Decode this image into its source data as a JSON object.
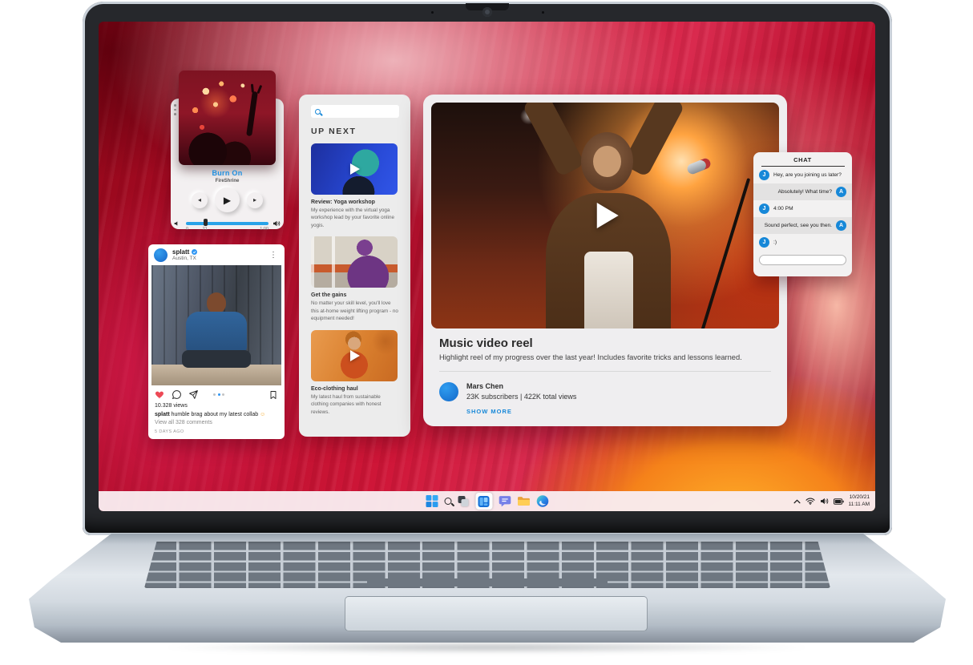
{
  "music_player": {
    "title": "Burn On",
    "artist": "FireShrine",
    "controls": {
      "prev": "◂",
      "play": "▶",
      "next": "▸"
    },
    "progress": {
      "start": "0",
      "current": "21",
      "end": "1:00"
    }
  },
  "social_post": {
    "username": "splatt",
    "location": "Austin, TX",
    "menu_icon": "⋮",
    "views": "10.328 views",
    "caption_author": "splatt",
    "caption_text": " humble brag about my latest collab ",
    "caption_emoji": "☺",
    "comments_link": "View all 328 comments",
    "posted": "5 DAYS AGO"
  },
  "up_next": {
    "header": "UP NEXT",
    "items": [
      {
        "title": "Review: Yoga workshop",
        "description": "My experience with the virtual yoga workshop lead by your favorite online yogis."
      },
      {
        "title": "Get the gains",
        "description": "No matter your skill level, you'll love this at-home weight lifting program - no equipment needed!"
      },
      {
        "title": "Eco-clothing haul",
        "description": "My latest haul from sustainable clothing companies with honest reviews."
      }
    ]
  },
  "video_player": {
    "title": "Music video reel",
    "description": "Highlight reel of my progress over the last year! Includes favorite tricks and lessons learned.",
    "channel_name": "Mars Chen",
    "channel_stats": "23K subscribers | 422K total views",
    "show_more": "SHOW MORE"
  },
  "chat": {
    "header": "CHAT",
    "messages": [
      {
        "avatar": "J",
        "side": "left",
        "text": "Hey, are you joining us later?"
      },
      {
        "avatar": "A",
        "side": "right",
        "text": "Absolutely! What time?"
      },
      {
        "avatar": "J",
        "side": "left",
        "text": "4:00 PM"
      },
      {
        "avatar": "A",
        "side": "right",
        "text": "Sound perfect, see you then."
      },
      {
        "avatar": "J",
        "side": "left",
        "text": ":)"
      }
    ]
  },
  "taskbar": {
    "date": "10/20/21",
    "time": "11:11 AM"
  },
  "colors": {
    "accent_blue": "#1788d8",
    "taskbar_bg": "#f7e9ec",
    "wallpaper_red": "#c81236",
    "wallpaper_orange": "#f5921e"
  }
}
